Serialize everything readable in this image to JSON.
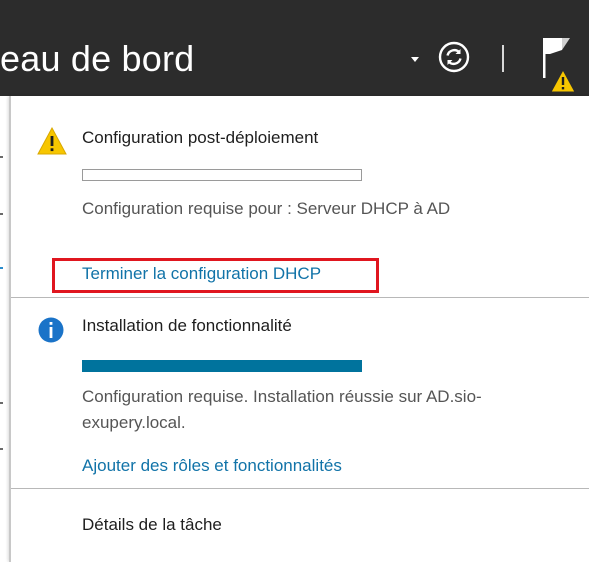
{
  "header": {
    "title": "eau de bord"
  },
  "notifications": [
    {
      "type": "warning",
      "title": "Configuration post-déploiement",
      "progress": 0,
      "description": "Configuration requise pour : Serveur DHCP à AD",
      "action": "Terminer la configuration DHCP"
    },
    {
      "type": "info",
      "title": "Installation de fonctionnalité",
      "progress": 1.0,
      "description": "Configuration requise. Installation réussie sur AD.sio-exupery.local.",
      "action": "Ajouter des rôles et fonctionnalités"
    }
  ],
  "footer": {
    "task_details": "Détails de la tâche"
  },
  "colors": {
    "titlebar": "#2c2c2c",
    "link": "#1173a8",
    "progress": "#00739d",
    "warning": "#f7c600",
    "info": "#1a73c8",
    "highlight": "#e0161f"
  }
}
